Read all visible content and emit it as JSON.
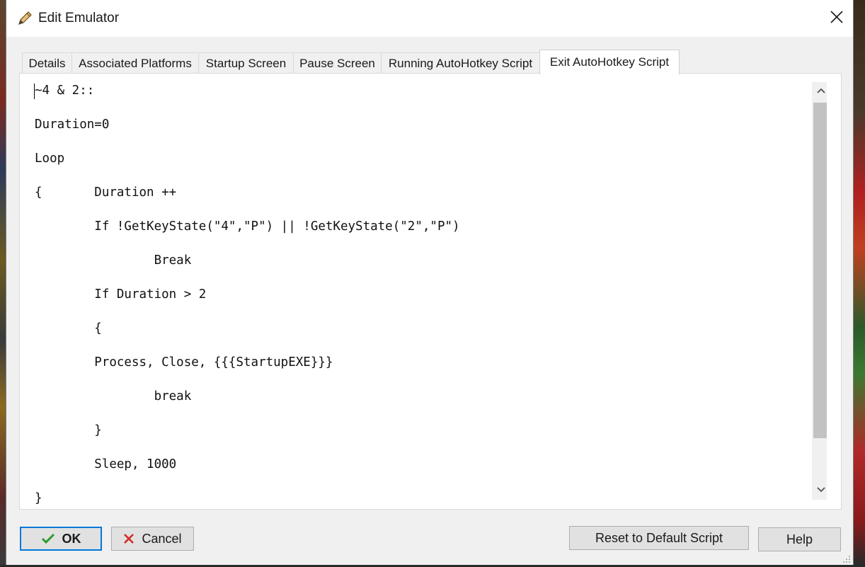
{
  "window": {
    "title": "Edit Emulator"
  },
  "tabs": [
    {
      "label": "Details"
    },
    {
      "label": "Associated Platforms"
    },
    {
      "label": "Startup Screen"
    },
    {
      "label": "Pause Screen"
    },
    {
      "label": "Running AutoHotkey Script"
    },
    {
      "label": "Exit AutoHotkey Script",
      "active": true
    }
  ],
  "editor": {
    "lines": [
      "~4 & 2::",
      "Duration=0",
      "Loop",
      "{       Duration ++",
      "        If !GetKeyState(\"4\",\"P\") || !GetKeyState(\"2\",\"P\")",
      "                Break",
      "        If Duration > 2",
      "        {",
      "        Process, Close, {{{StartupEXE}}}",
      "                break",
      "        }",
      "        Sleep, 1000",
      "}"
    ]
  },
  "buttons": {
    "ok": "OK",
    "cancel": "Cancel",
    "reset": "Reset to Default Script",
    "help": "Help"
  },
  "icons": {
    "title": "pencil-icon",
    "close": "close-icon",
    "ok": "checkmark-icon",
    "cancel": "x-icon"
  },
  "colors": {
    "accent": "#0078d7",
    "ok_check": "#2e9c2e",
    "cancel_x": "#d42a2a"
  }
}
